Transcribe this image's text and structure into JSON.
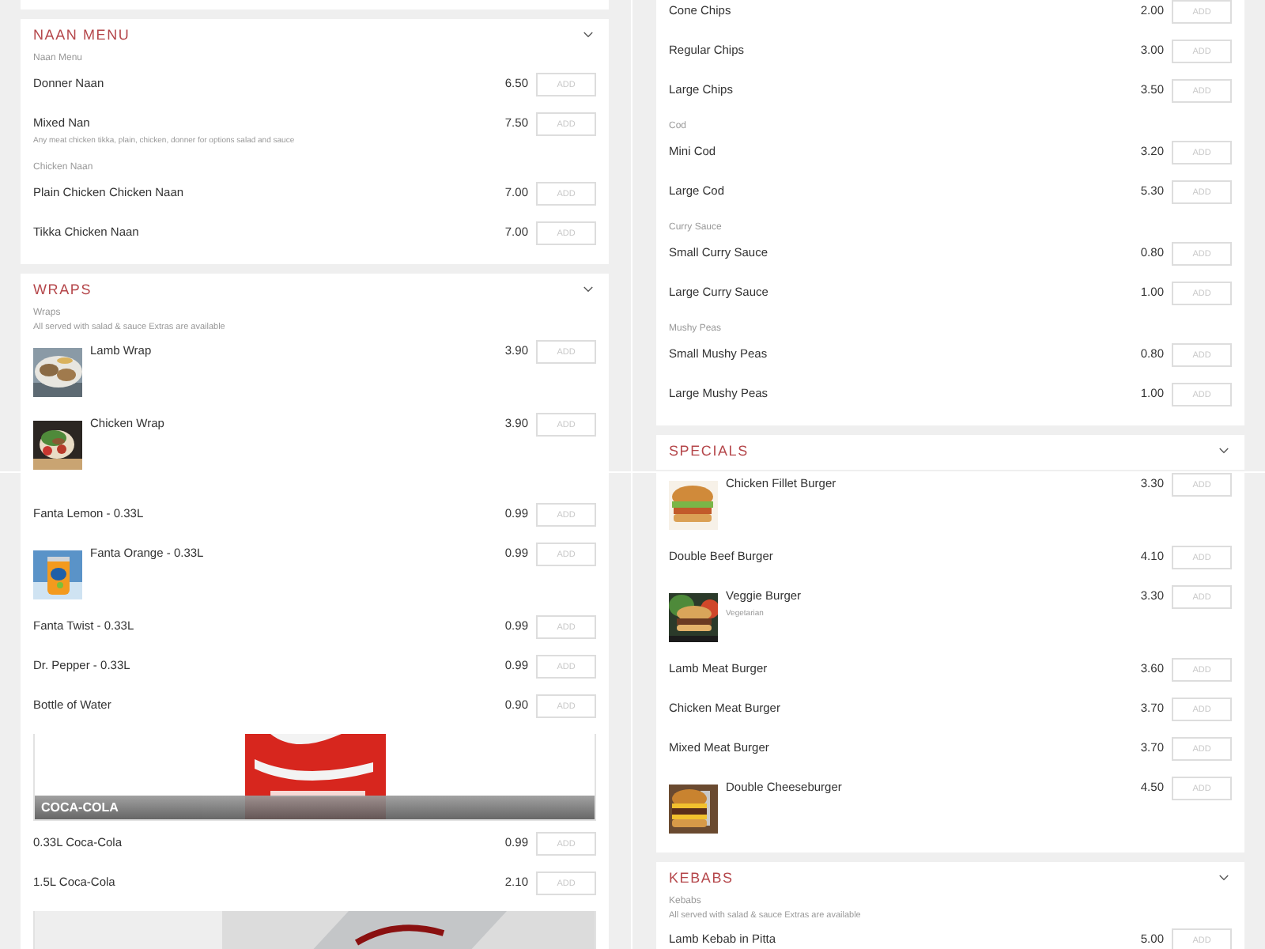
{
  "panels": [
    {
      "cards": [
        {
          "kind": "end"
        },
        {
          "kind": "section",
          "title": "NAAN MENU",
          "entries": [
            {
              "kind": "group",
              "label": "Naan Menu"
            },
            {
              "kind": "item",
              "name": "Donner Naan",
              "price": "6.50",
              "button": "ADD"
            },
            {
              "kind": "item",
              "name": "Mixed Nan",
              "description": "Any meat chicken tikka, plain, chicken, donner for options salad and sauce",
              "price": "7.50",
              "button": "ADD"
            },
            {
              "kind": "group",
              "label": "Chicken Naan"
            },
            {
              "kind": "item",
              "name": "Plain Chicken Chicken Naan",
              "price": "7.00",
              "button": "ADD"
            },
            {
              "kind": "item",
              "name": "Tikka Chicken Naan",
              "price": "7.00",
              "button": "ADD"
            }
          ]
        },
        {
          "kind": "section",
          "title": "WRAPS",
          "entries": [
            {
              "kind": "group",
              "label": "Wraps",
              "note": "All served with salad & sauce Extras are available"
            },
            {
              "kind": "picture-item",
              "name": "Lamb Wrap",
              "price": "3.90",
              "button": "ADD"
            },
            {
              "kind": "picture-item",
              "name": "Chicken Wrap",
              "price": "3.90",
              "button": "ADD"
            }
          ]
        }
      ]
    },
    {
      "cards": [
        {
          "kind": "continued",
          "entries": [
            {
              "kind": "item",
              "name": "Cone Chips",
              "price": "2.00",
              "button": "ADD"
            },
            {
              "kind": "item",
              "name": "Regular Chips",
              "price": "3.00",
              "button": "ADD"
            },
            {
              "kind": "item",
              "name": "Large Chips",
              "price": "3.50",
              "button": "ADD"
            },
            {
              "kind": "group",
              "label": "Cod"
            },
            {
              "kind": "item",
              "name": "Mini Cod",
              "price": "3.20",
              "button": "ADD"
            },
            {
              "kind": "item",
              "name": "Large Cod",
              "price": "5.30",
              "button": "ADD"
            },
            {
              "kind": "group",
              "label": "Curry Sauce"
            },
            {
              "kind": "item",
              "name": "Small Curry Sauce",
              "price": "0.80",
              "button": "ADD"
            },
            {
              "kind": "item",
              "name": "Large Curry Sauce",
              "price": "1.00",
              "button": "ADD"
            },
            {
              "kind": "group",
              "label": "Mushy Peas"
            },
            {
              "kind": "item",
              "name": "Small Mushy Peas",
              "price": "0.80",
              "button": "ADD"
            },
            {
              "kind": "item",
              "name": "Large Mushy Peas",
              "price": "1.00",
              "button": "ADD"
            }
          ]
        },
        {
          "kind": "section",
          "title": "SPECIALS"
        }
      ]
    },
    {
      "cards": [
        {
          "kind": "continued",
          "entries": [
            {
              "kind": "item",
              "name": "Fanta Lemon - 0.33L",
              "price": "0.99",
              "button": "ADD"
            },
            {
              "kind": "picture-item",
              "name": "Fanta Orange - 0.33L",
              "price": "0.99",
              "button": "ADD"
            },
            {
              "kind": "item",
              "name": "Fanta Twist - 0.33L",
              "price": "0.99",
              "button": "ADD"
            },
            {
              "kind": "item",
              "name": "Dr. Pepper - 0.33L",
              "price": "0.99",
              "button": "ADD"
            },
            {
              "kind": "item",
              "name": "Bottle of Water",
              "price": "0.90",
              "button": "ADD"
            },
            {
              "kind": "banner",
              "title": "COCA-COLA"
            },
            {
              "kind": "item",
              "name": "0.33L Coca-Cola",
              "price": "0.99",
              "button": "ADD"
            },
            {
              "kind": "item",
              "name": "1.5L Coca-Cola",
              "price": "2.10",
              "button": "ADD"
            },
            {
              "kind": "banner"
            }
          ]
        }
      ]
    },
    {
      "cards": [
        {
          "kind": "continued",
          "entries": [
            {
              "kind": "picture-item",
              "name": "Chicken Fillet Burger",
              "price": "3.30",
              "button": "ADD"
            },
            {
              "kind": "item",
              "name": "Double Beef Burger",
              "price": "4.10",
              "button": "ADD"
            },
            {
              "kind": "picture-item",
              "name": "Veggie Burger",
              "description": "Vegetarian",
              "price": "3.30",
              "button": "ADD"
            },
            {
              "kind": "item",
              "name": "Lamb Meat Burger",
              "price": "3.60",
              "button": "ADD"
            },
            {
              "kind": "item",
              "name": "Chicken Meat Burger",
              "price": "3.70",
              "button": "ADD"
            },
            {
              "kind": "item",
              "name": "Mixed Meat Burger",
              "price": "3.70",
              "button": "ADD"
            },
            {
              "kind": "picture-item",
              "name": "Double Cheeseburger",
              "price": "4.50",
              "button": "ADD"
            }
          ]
        },
        {
          "kind": "section",
          "title": "KEBABS",
          "entries": [
            {
              "kind": "group",
              "label": "Kebabs",
              "note": "All served with salad & sauce Extras are available"
            },
            {
              "kind": "item",
              "name": "Lamb Kebab in Pitta",
              "price": "5.00",
              "button": "ADD"
            }
          ]
        }
      ]
    }
  ]
}
